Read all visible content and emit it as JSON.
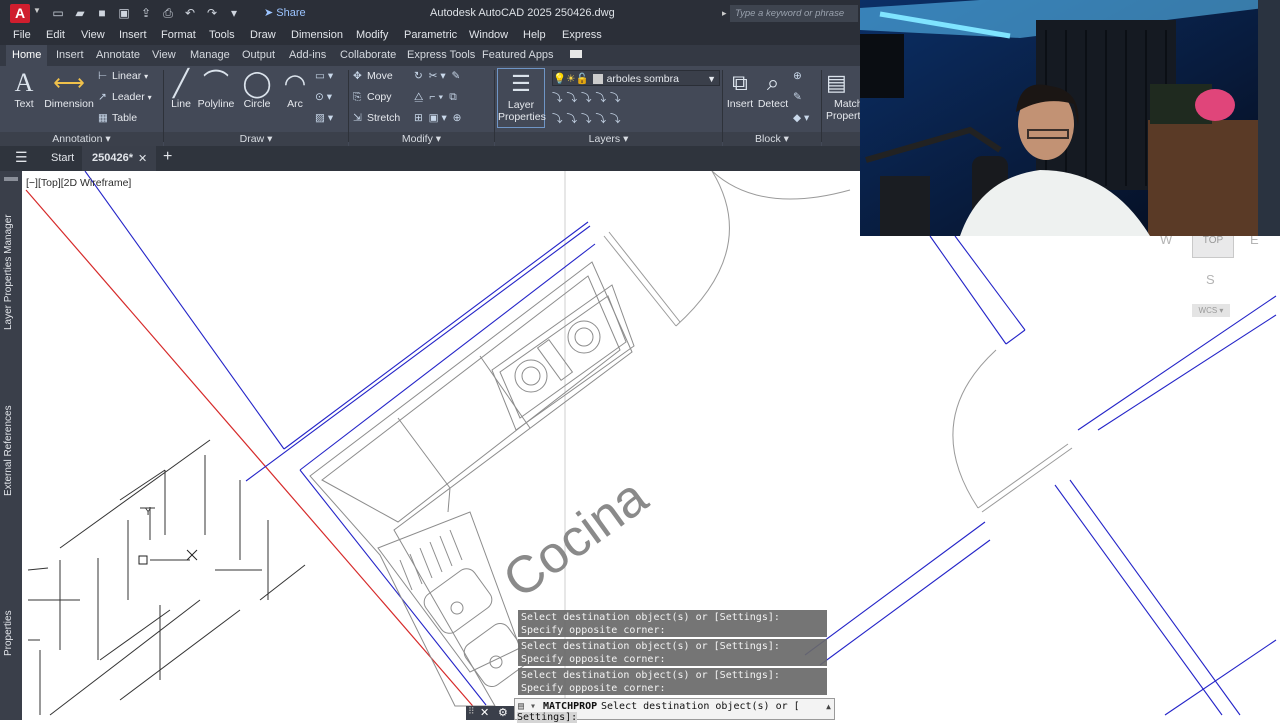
{
  "app": {
    "logo_letter": "A",
    "share_label": "Share",
    "title": "Autodesk AutoCAD 2025    250426.dwg",
    "search_placeholder": "Type a keyword or phrase"
  },
  "menu": [
    "File",
    "Edit",
    "View",
    "Insert",
    "Format",
    "Tools",
    "Draw",
    "Dimension",
    "Modify",
    "Parametric",
    "Window",
    "Help",
    "Express"
  ],
  "ribbon_tabs": [
    "Home",
    "Insert",
    "Annotate",
    "View",
    "Manage",
    "Output",
    "Add-ins",
    "Collaborate",
    "Express Tools",
    "Featured Apps"
  ],
  "ribbon": {
    "text": "Text",
    "dimension": "Dimension",
    "linear": "Linear",
    "leader": "Leader",
    "table": "Table",
    "line": "Line",
    "polyline": "Polyline",
    "circle": "Circle",
    "arc": "Arc",
    "move": "Move",
    "copy": "Copy",
    "stretch": "Stretch",
    "layer_properties_1": "Layer",
    "layer_properties_2": "Properties",
    "layer_current": "arboles sombra",
    "insert": "Insert",
    "detect": "Detect",
    "match_1": "Match",
    "match_2": "Propert"
  },
  "panels": {
    "annotation": "Annotation",
    "draw": "Draw",
    "modify": "Modify",
    "layers": "Layers",
    "block": "Block"
  },
  "doc_tabs": {
    "start": "Start",
    "file": "250426*"
  },
  "viewport_label": "[−][Top][2D Wireframe]",
  "side_palettes": [
    "Layer Properties Manager",
    "External References",
    "Properties"
  ],
  "drawing": {
    "room_label": "Cocina"
  },
  "command": {
    "history": [
      "Select destination object(s) or [Settings]: Specify opposite corner:",
      "Select destination object(s) or [Settings]: Specify opposite corner:",
      "Select destination object(s) or [Settings]: Specify opposite corner:"
    ],
    "command_name": "MATCHPROP",
    "prompt": "Select destination object(s) or [",
    "prompt_cont": "Settings]:"
  },
  "navcube": {
    "face": "TOP",
    "south": "S",
    "east": "E",
    "west": "W",
    "wcs": "WCS"
  },
  "colors": {
    "wall_blue": "#2424c8",
    "boundary_red": "#d62a2a",
    "ui_dark": "#2b2f38",
    "ribbon": "#434957"
  }
}
